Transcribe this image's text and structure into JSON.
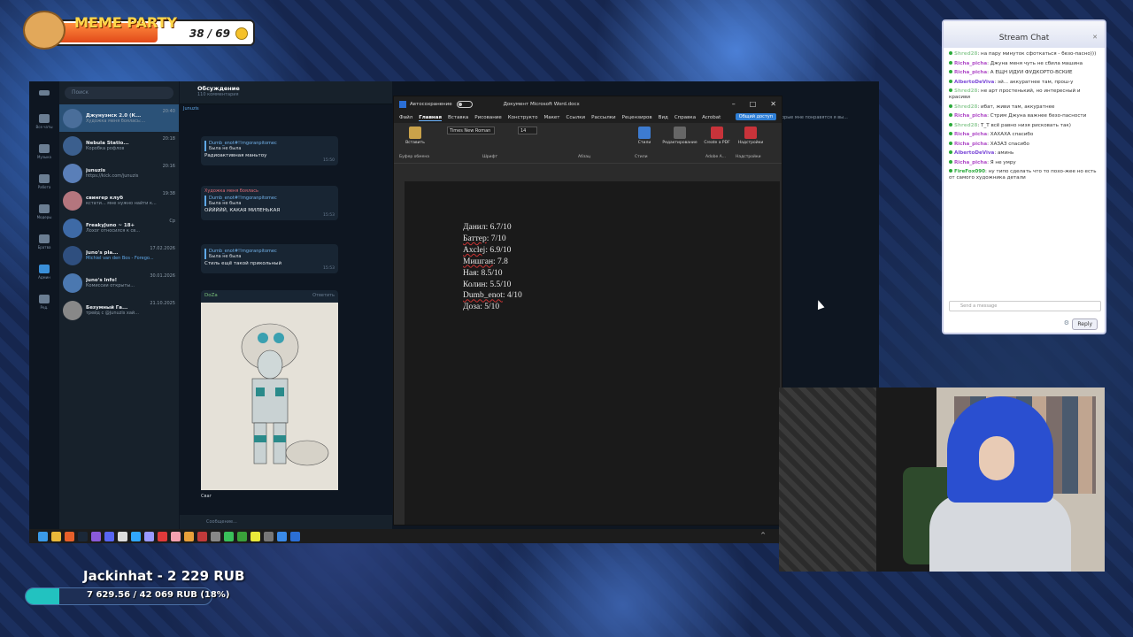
{
  "meme_party": {
    "title": "MEME PARTY",
    "count": "38 / 69"
  },
  "telegram": {
    "search_placeholder": "Поиск",
    "folders": [
      {
        "label": "Все чаты"
      },
      {
        "label": "Музыка"
      },
      {
        "label": "Работа"
      },
      {
        "label": "Модеры"
      },
      {
        "label": "Братва"
      },
      {
        "label": "Админ"
      },
      {
        "label": "Ред."
      }
    ],
    "chats": [
      {
        "name": "Джунуэнск 2.0 (К...",
        "time": "20:40",
        "preview": "Художка меня боялась:..."
      },
      {
        "name": "Nebula Statio...",
        "time": "20:18",
        "preview": "Коробка рофлов"
      },
      {
        "name": "junuzis",
        "time": "20:16",
        "preview": "https://kick.com/junuzis"
      },
      {
        "name": "свингер клуб",
        "time": "19:38",
        "preview": "кстати... мне нужно найти к..."
      },
      {
        "name": "FreakyJuno ~ 18+",
        "time": "Ср",
        "preview": "Лохог относился к св..."
      },
      {
        "name": "Juno's pla...",
        "time": "17.02.2026",
        "preview": "Michiel van den Bos - Forego..."
      },
      {
        "name": "Juno's Info!",
        "time": "30.01.2026",
        "preview": "Комиссии открыты..."
      },
      {
        "name": "Безумный Га...",
        "time": "21.10.2025",
        "preview": "трейд с @junuzis хай..."
      }
    ],
    "discussion_title": "Обсуждение",
    "discussion_sub": "110 комментария",
    "pinned_author": "Junuzis",
    "pinned_text": "Меня в последнее время смачно пропирает по китайской эстетике, так что...",
    "messages": [
      {
        "quote_name": "Dumb_enot#!!mgoranpitomec",
        "quote": "Была не была",
        "body": "Радиоактивная маньтоу",
        "time": "15:50"
      },
      {
        "author": "Художка меня боялась",
        "quote_name": "Dumb_enot#!!mgoranpitomec",
        "quote": "Была не была",
        "body": "ОЙЙЙЙЙ, КАКАЯ МИЛЕНЬКАЯ",
        "time": "15:53"
      },
      {
        "quote_name": "Dumb_enot#!!mgoranpitomec",
        "quote": "Была не была",
        "body": "Стиль ещё такой прикольный",
        "time": "15:53"
      }
    ],
    "image_author": "DoZa",
    "reply_label": "Ответить",
    "image_caption": "Сваг",
    "compose_placeholder": "Сообщение...",
    "right_info": "орые мне понравятся я вы..."
  },
  "word": {
    "autosave": "Автосохранение",
    "doc_title": "Документ Microsoft Word.docx",
    "menu": [
      "Файл",
      "Главная",
      "Вставка",
      "Рисование",
      "Конструкто",
      "Макет",
      "Ссылки",
      "Рассылки",
      "Рецензиров",
      "Вид",
      "Справка",
      "Acrobat"
    ],
    "share": "Общий доступ",
    "font": "Times New Roman",
    "size": "14",
    "groups": [
      "Буфер обмена",
      "Шрифт",
      "Абзац",
      "Стили",
      "Adobe A...",
      "Надстройки"
    ],
    "buttons": [
      "Вставить",
      "Стили",
      "Редактирование",
      "Create a PDF",
      "Надстройки"
    ],
    "lines": [
      {
        "name": "Данил",
        "score": ": 6.7/10"
      },
      {
        "name": "Баттер",
        "score": ": 7/10"
      },
      {
        "name": "Axclej",
        "score": ": 6.9/10"
      },
      {
        "name": "Мишган",
        "score": ": 7.8"
      },
      {
        "name": "Ная",
        "score": ": 8.5/10"
      },
      {
        "name": "Колин",
        "score": ": 5.5/10"
      },
      {
        "name": "Dumb_enot",
        "score": ": 4/10"
      },
      {
        "name": "Доза",
        "score": ": 5/10"
      }
    ]
  },
  "stream_chat": {
    "title": "Stream Chat",
    "input_placeholder": "Send a message",
    "reply": "Reply",
    "messages": [
      {
        "user": "Shred28",
        "color": "#9ad0a0",
        "text": "на пару минуток сфоткаться - безо-пасно)))"
      },
      {
        "user": "Richa_picha",
        "color": "#b04cc8",
        "text": "Джуна меня чуть не сбила машина"
      },
      {
        "user": "Richa_picha",
        "color": "#b04cc8",
        "text": "А ЕЩН ИДУИ ФУДКОРТО-ВСКИЕ"
      },
      {
        "user": "AlbertoDeViva",
        "color": "#7b48d8",
        "text": "эй... аккуратнее там, прош-у"
      },
      {
        "user": "Shred28",
        "color": "#9ad0a0",
        "text": "не арт простенький, но интересный и красиви"
      },
      {
        "user": "Shred28",
        "color": "#9ad0a0",
        "text": "ибат, живи там, аккуратнее"
      },
      {
        "user": "Richa_picha",
        "color": "#b04cc8",
        "text": "Стрим Джуна важнее безо-пасности"
      },
      {
        "user": "Shred28",
        "color": "#9ad0a0",
        "text": "Т_Т всё равно низя рисковать так)"
      },
      {
        "user": "Richa_picha",
        "color": "#b04cc8",
        "text": "ХАХАХА спасибо"
      },
      {
        "user": "Richa_picha",
        "color": "#b04cc8",
        "text": "ХАЗАЗ спасибо"
      },
      {
        "user": "AlbertoDeViva",
        "color": "#7b48d8",
        "text": "аминь"
      },
      {
        "user": "Richa_picha",
        "color": "#b04cc8",
        "text": "Я не умру"
      },
      {
        "user": "FireFox090",
        "color": "#2aaa3a",
        "text": "ну типо сделать что то похо-жее но есть от самого художника детали"
      }
    ]
  },
  "donation": {
    "title": "Jackinhat - 2 229 RUB",
    "progress_text": "7 629.56 / 42 069 RUB (18%)",
    "progress": 0.18
  }
}
